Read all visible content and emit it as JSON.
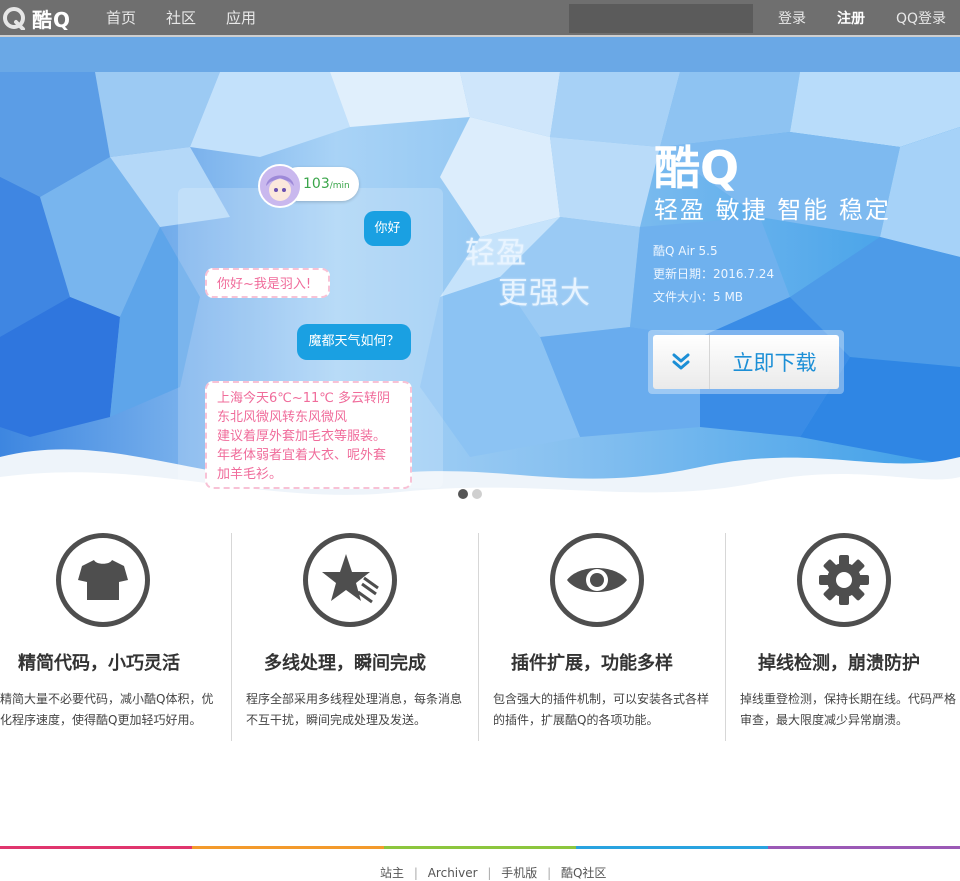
{
  "header": {
    "logo_text": "酷Q",
    "nav": [
      "首页",
      "社区",
      "应用"
    ],
    "search_value": "",
    "login": "登录",
    "register": "注册",
    "qq_login": "QQ登录"
  },
  "banner": {
    "speed_value": "103",
    "speed_unit": "/min",
    "bubble_hello": "你好",
    "bubble_intro": "你好~我是羽入!",
    "bubble_weather_q": "魔都天气如何？",
    "bubble_weather_a": [
      "上海今天6℃~11℃ 多云转阴",
      "东北风微风转东风微风",
      "建议着厚外套加毛衣等服装。",
      "年老体弱者宜着大衣、呢外套",
      "加羊毛衫。"
    ],
    "slogan_line1": "轻盈",
    "slogan_line2": "更强大",
    "product_name": "酷Q",
    "tagline": "轻盈 敏捷 智能 稳定",
    "version": "酷Q Air 5.5",
    "update_date": "更新日期：2016.7.24",
    "file_size": "文件大小：5 MB",
    "download_label": "立即下载",
    "slide_count": 2,
    "active_slide": 1
  },
  "features": [
    {
      "icon": "tshirt-icon",
      "title": "精简代码，小巧灵活",
      "desc_lines": [
        "精简大量不必要代码，减小酷Q体积，优",
        "化程序速度，使得酷Q更加轻巧好用。"
      ]
    },
    {
      "icon": "star-icon",
      "title": "多线处理，瞬间完成",
      "desc_lines": [
        "程序全部采用多线程处理消息，每条消息",
        "不互干扰，瞬间完成处理及发送。"
      ]
    },
    {
      "icon": "eye-icon",
      "title": "插件扩展，功能多样",
      "desc_lines": [
        "包含强大的插件机制，可以安装各式各样",
        "的插件，扩展酷Q的各项功能。"
      ]
    },
    {
      "icon": "gear-icon",
      "title": "掉线检测，崩溃防护",
      "desc_lines": [
        "掉线重登检测，保持长期在线。代码严格",
        "审查，最大限度减少异常崩溃。"
      ]
    }
  ],
  "footer": {
    "colors": [
      "#e0356e",
      "#f39a2c",
      "#8cc63e",
      "#29a3e0",
      "#9b59b6"
    ],
    "links": [
      "站主",
      "Archiver",
      "手机版",
      "酷Q社区"
    ],
    "separator": "|"
  }
}
